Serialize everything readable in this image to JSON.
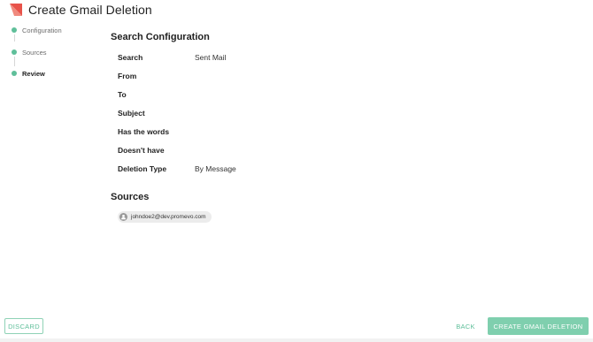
{
  "header": {
    "title": "Create Gmail Deletion",
    "logo_icon": "red-triangle-logo"
  },
  "stepper": {
    "steps": [
      {
        "label": "Configuration",
        "state": "done"
      },
      {
        "label": "Sources",
        "state": "done"
      },
      {
        "label": "Review",
        "state": "active"
      }
    ],
    "accent_color": "#5fbf9a"
  },
  "search_configuration": {
    "title": "Search Configuration",
    "fields": [
      {
        "label": "Search",
        "value": "Sent Mail"
      },
      {
        "label": "From",
        "value": ""
      },
      {
        "label": "To",
        "value": ""
      },
      {
        "label": "Subject",
        "value": ""
      },
      {
        "label": "Has the words",
        "value": ""
      },
      {
        "label": "Doesn't have",
        "value": ""
      },
      {
        "label": "Deletion Type",
        "value": "By Message"
      }
    ]
  },
  "sources": {
    "title": "Sources",
    "items": [
      {
        "email": "johndoe2@dev.promevo.com",
        "icon": "user-icon"
      }
    ]
  },
  "footer": {
    "discard_label": "DISCARD",
    "back_label": "BACK",
    "create_label": "CREATE GMAIL DELETION"
  },
  "colors": {
    "brand_red": "#e8534a",
    "accent_green": "#5fbf9a",
    "primary_button": "#7fcfae"
  }
}
